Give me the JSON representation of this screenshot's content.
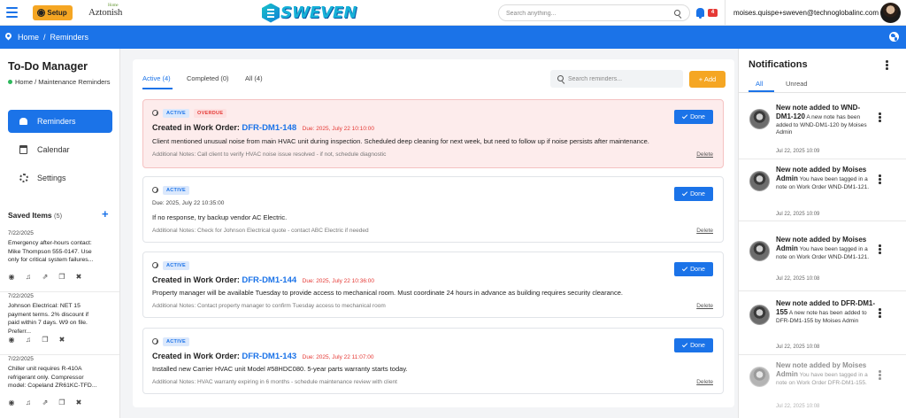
{
  "topbar": {
    "setup_label": "Setup",
    "brand_left": "Aztonish",
    "brand_left_tag": "Home",
    "logo_text": "SWEVEN",
    "search_placeholder": "Search anything...",
    "notification_count": "4",
    "user_email": "moises.quispe+sweven@technoglobalinc.com"
  },
  "breadcrumb": {
    "home": "Home",
    "separator": "/",
    "current": "Reminders"
  },
  "sidebar": {
    "title": "To-Do Manager",
    "crumb": "Home / Maintenance Reminders",
    "nav": [
      {
        "label": "Reminders",
        "icon": "bell-icon",
        "active": true
      },
      {
        "label": "Calendar",
        "icon": "calendar-icon",
        "active": false
      },
      {
        "label": "Settings",
        "icon": "gear-icon",
        "active": false
      }
    ],
    "saved_title": "Saved Items",
    "saved_count": "(5)",
    "saved_items": [
      {
        "date": "7/22/2025",
        "text": "Emergency after-hours contact: Mike Thompson 555-0147. Use only for critical system failures..."
      },
      {
        "date": "7/22/2025",
        "text": "Johnson Electrical: NET 15 payment terms. 2% discount if paid within 7 days. W9 on file. Preferr..."
      },
      {
        "date": "7/22/2025",
        "text": "Chiller unit requires R-410A refrigerant only. Compressor model: Copeland ZR61KC-TFD..."
      }
    ]
  },
  "main": {
    "tabs": [
      {
        "label": "Active (4)",
        "active": true
      },
      {
        "label": "Completed (0)",
        "active": false
      },
      {
        "label": "All (4)",
        "active": false
      }
    ],
    "search_placeholder": "Search reminders...",
    "add_label": "+ Add",
    "done_label": "Done",
    "delete_label": "Delete",
    "status_active": "ACTIVE",
    "status_overdue": "OVERDUE",
    "cards": [
      {
        "has_title": true,
        "overdue": true,
        "title_prefix": "Created in Work Order:",
        "work_order": "DFR-DM1-148",
        "due": "Due: 2025, July 22 10:10:00",
        "description": "Client mentioned unusual noise from main HVAC unit during inspection. Scheduled deep cleaning for next week, but need to follow up if noise persists after maintenance.",
        "notes": "Additional Notes: Call client to verify HVAC noise issue resolved - if not, schedule diagnostic"
      },
      {
        "has_title": false,
        "overdue": false,
        "due": "Due: 2025, July 22 10:35:00",
        "description": "If no response, try backup vendor AC Electric.",
        "notes": "Additional Notes: Check for Johnson Electrical quote - contact ABC Electric if needed"
      },
      {
        "has_title": true,
        "overdue": false,
        "title_prefix": "Created in Work Order:",
        "work_order": "DFR-DM1-144",
        "due": "Due: 2025, July 22 10:36:00",
        "description": "Property manager will be available Tuesday to provide access to mechanical room. Must coordinate 24 hours in advance as building requires security clearance.",
        "notes": "Additional Notes: Contact property manager to confirm Tuesday access to mechanical room"
      },
      {
        "has_title": true,
        "overdue": false,
        "title_prefix": "Created in Work Order:",
        "work_order": "DFR-DM1-143",
        "due": "Due: 2025, July 22 11:07:00",
        "description": "Installed new Carrier HVAC unit Model #58HDC080. 5-year parts warranty starts today.",
        "notes": "Additional Notes: HVAC warranty expiring in 6 months - schedule maintenance review with client"
      }
    ]
  },
  "notifications": {
    "title": "Notifications",
    "tabs": [
      {
        "label": "All",
        "active": true
      },
      {
        "label": "Unread",
        "active": false
      }
    ],
    "items": [
      {
        "title": "New note added to WND-DM1-120",
        "body": "A new note has been added to WND-DM1-120 by Moises Admin",
        "date": "Jul 22, 2025 10:09",
        "faded": false
      },
      {
        "title": "New note added by Moises Admin",
        "body": "You have been tagged in a note on Work Order WND-DM1-121.",
        "date": "Jul 22, 2025 10:09",
        "faded": false
      },
      {
        "title": "New note added by Moises Admin",
        "body": "You have been tagged in a note on Work Order WND-DM1-121.",
        "date": "Jul 22, 2025 10:08",
        "faded": false
      },
      {
        "title": "New note added to DFR-DM1-155",
        "body": "A new note has been added to DFR-DM1-155 by Moises Admin",
        "date": "Jul 22, 2025 10:08",
        "faded": false
      },
      {
        "title": "New note added by Moises Admin",
        "body": "You have been tagged in a note on Work Order DFR-DM1-155.",
        "date": "Jul 22, 2025 10:08",
        "faded": true
      }
    ]
  }
}
